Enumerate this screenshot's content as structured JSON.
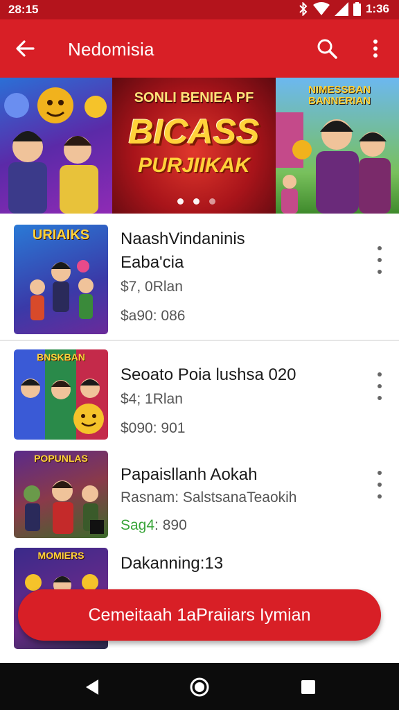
{
  "status_bar": {
    "time": "28:15",
    "time_right": "1:36",
    "icons": [
      "bluetooth-icon",
      "wifi-icon",
      "signal-icon",
      "battery-icon"
    ]
  },
  "app_bar": {
    "title": "Nedomisia",
    "icons": [
      "back-arrow-icon",
      "search-icon",
      "more-vert-icon"
    ]
  },
  "banner": {
    "headline": "SONLI BENIEA PF",
    "big_text": "BICASS",
    "sub_text": "PURJIIKAK",
    "right_panel_text": "NIMESSBAN BANNERIAN",
    "page_indicator": {
      "count": 3,
      "active": 1
    }
  },
  "games": [
    {
      "thumb_label": "URIAIKS",
      "name_line1": "NaashVindaninis",
      "name_line2": "Eaba'cia",
      "meta": "$7, 0Rlan",
      "price": "$a90: 086",
      "price_accent": ""
    },
    {
      "thumb_label": "BNSKBAN",
      "name_line1": "Seoato Poia lushsa 020",
      "name_line2": "",
      "meta": "$4; 1Rlan",
      "price": "$090: 901",
      "price_accent": ""
    },
    {
      "thumb_label": "POPUNLAS",
      "name_line1": "Papaisllanh Aokah",
      "name_line2": "",
      "meta": "Rasnam: SalstsanaTeaokih",
      "price": ": 890",
      "price_accent": "Sag4"
    },
    {
      "thumb_label": "MOMIERS",
      "name_line1": "Dakanning:13",
      "name_line2": "",
      "meta": "",
      "price": "",
      "price_accent": ""
    }
  ],
  "cta": {
    "label": "Cemeitaah 1aPraiiars Iymian"
  },
  "colors": {
    "brand_red": "#d81f26",
    "status_red": "#b4141c",
    "price_green": "#3aa53a",
    "nav_black": "#0c0c0c"
  },
  "nav_icons": [
    "nav-back-icon",
    "nav-home-icon",
    "nav-recents-icon"
  ]
}
